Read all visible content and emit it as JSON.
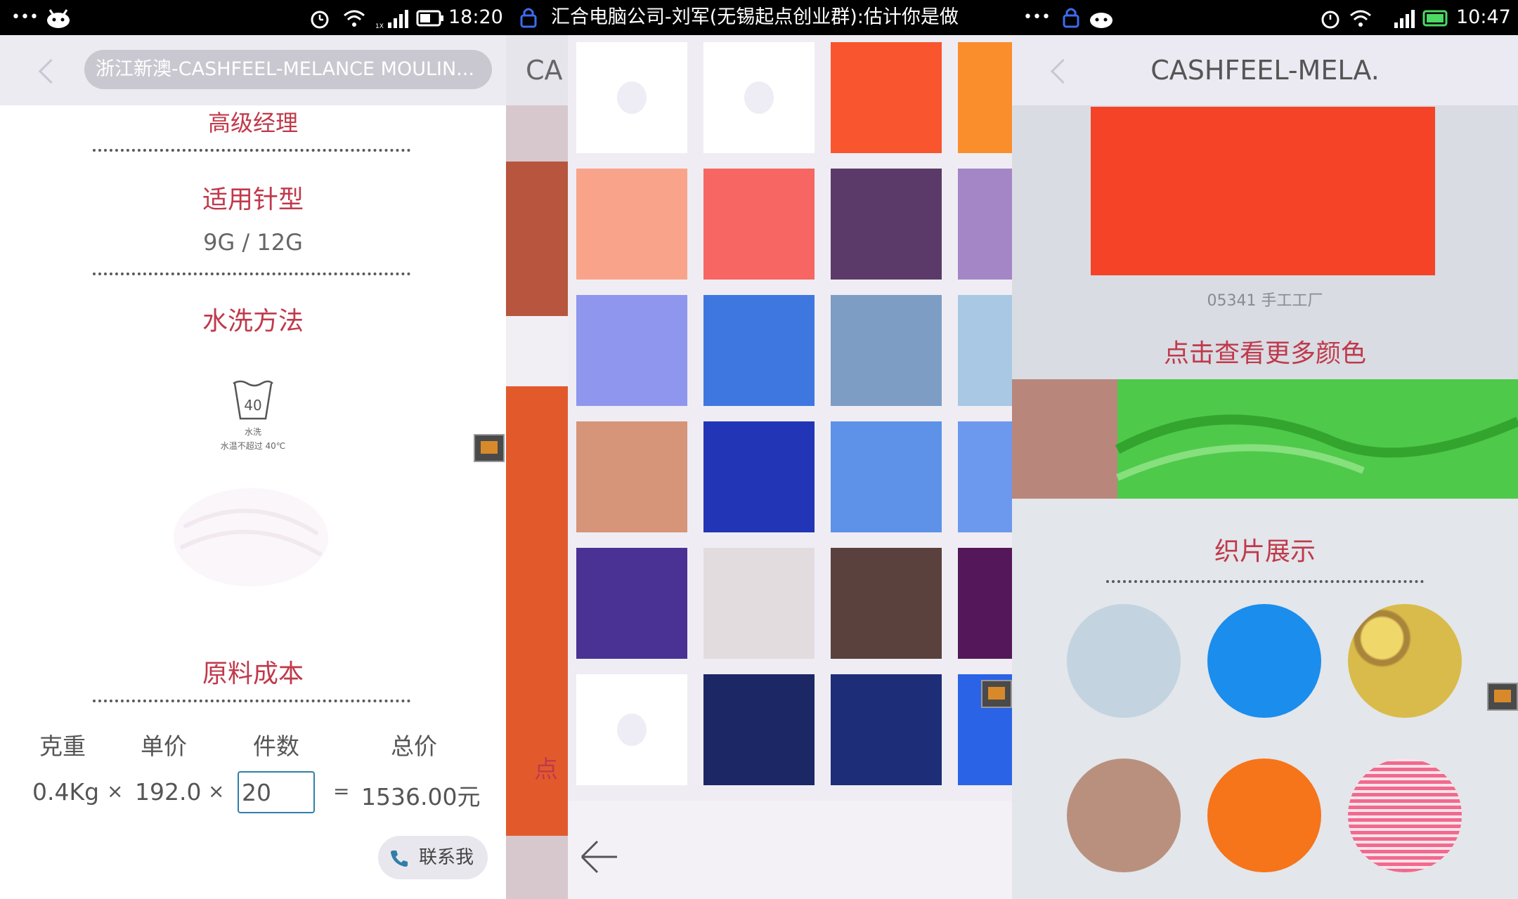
{
  "panel1": {
    "status": {
      "dots": "•••",
      "time": "18:20"
    },
    "header": {
      "title": "浙江新澳-CASHFEEL-MELANCE MOULIN..."
    },
    "job_title": "高级经理",
    "needle": {
      "title": "适用针型",
      "value": "9G / 12G"
    },
    "wash": {
      "title": "水洗方法",
      "icon_value": "40",
      "icon_line1": "水洗",
      "icon_line2": "水温不超过 40℃"
    },
    "cost": {
      "title": "原料成本",
      "headers": [
        "克重",
        "单价",
        "件数",
        "总价"
      ],
      "weight": "0.4Kg",
      "times1": "×",
      "unit_price": "192.0",
      "times2": "×",
      "pieces": "20",
      "equals": "=",
      "total": "1536.00元"
    },
    "contact_label": "联系我"
  },
  "panel2": {
    "notification": "汇合电脑公司-刘军(无锡起点创业群):估计你是做",
    "left_partial": {
      "title": "CA",
      "link_char": "点"
    },
    "swatch_colors": [
      [
        "blank",
        "blank",
        "#f9552f",
        "#fb8e2c"
      ],
      [
        "#f9a48a",
        "#f76662",
        "#5b3a6a",
        "#a486c6"
      ],
      [
        "#8f96ee",
        "#3f77e0",
        "#7d9dc4",
        "#a8c8e3"
      ],
      [
        "#d69478",
        "#2135b6",
        "#5d92e8",
        "#6c99ee"
      ],
      [
        "#4a3294",
        "#e3dcdf",
        "#5a413e",
        "#54185a"
      ],
      [
        "blank",
        "#1c2765",
        "#1d2d78",
        "#2b63e6"
      ]
    ]
  },
  "panel3": {
    "status": {
      "dots": "•••",
      "time": "10:47"
    },
    "title": "CASHFEEL-MELA.",
    "swatch_color": "#f44326",
    "swatch_label": "05341 手工工厂",
    "more_colors": "点击查看更多颜色",
    "fabric_title": "织片展示",
    "circles": [
      "#c3d3e0",
      "#1b8ded",
      "#d8bb4b",
      "#b9907e",
      "#f6741a",
      "#f06a8e"
    ]
  },
  "colors": {
    "accent": "#c0394b",
    "header_bg": "#ecebf2",
    "input_border": "#2f7fa9"
  }
}
